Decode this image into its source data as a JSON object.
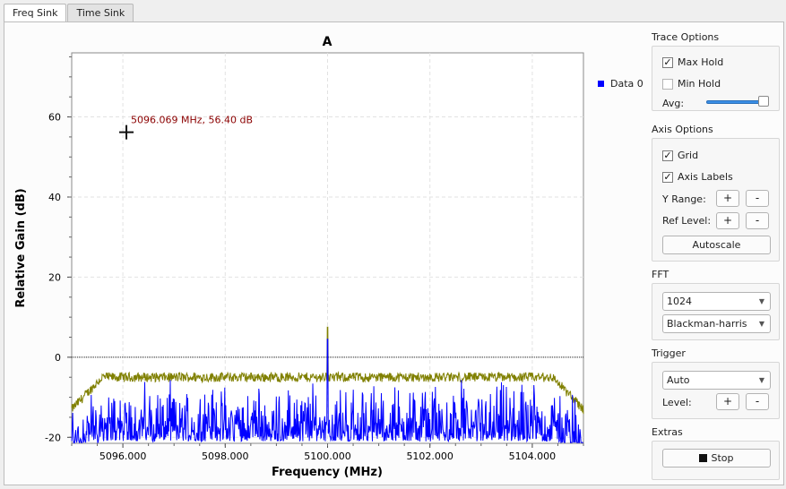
{
  "tabs": [
    {
      "label": "Freq Sink",
      "active": true
    },
    {
      "label": "Time Sink",
      "active": false
    }
  ],
  "plot": {
    "title": "A",
    "xlabel": "Frequency (MHz)",
    "ylabel": "Relative Gain (dB)",
    "legend": "Data 0",
    "legend_color": "#0000ff",
    "marker_readout": "5096.069 MHz, 56.40 dB"
  },
  "chart_data": {
    "type": "line",
    "title": "A",
    "xlabel": "Frequency (MHz)",
    "ylabel": "Relative Gain (dB)",
    "xlim": [
      5095.0,
      5105.0
    ],
    "ylim": [
      -21.5,
      76
    ],
    "x_ticks": [
      "5096.000",
      "5098.000",
      "5100.000",
      "5102.000",
      "5104.000"
    ],
    "x_tick_values": [
      5096,
      5098,
      5100,
      5102,
      5104
    ],
    "y_ticks": [
      "60",
      "40",
      "20",
      "0",
      "-20"
    ],
    "y_tick_values": [
      60,
      40,
      20,
      0,
      -20
    ],
    "grid": true,
    "series": [
      {
        "name": "Data 0",
        "color": "#0000ff",
        "description": "noise floor trace",
        "floor_db_range": [
          -21,
          -5
        ],
        "peak": {
          "x": 5100.0,
          "y": 4.5
        }
      },
      {
        "color": "#808000",
        "description": "max hold trace",
        "level_db": -5,
        "edge_db": -13,
        "peak": {
          "x": 5100.0,
          "y": 7.5
        }
      }
    ],
    "marker": {
      "x": 5096.069,
      "y": 56.4
    },
    "reference_line_db": 0
  },
  "trace_options": {
    "title": "Trace Options",
    "max_hold": {
      "label": "Max Hold",
      "checked": true
    },
    "min_hold": {
      "label": "Min Hold",
      "checked": false
    },
    "avg_label": "Avg:",
    "avg_value": 1.0
  },
  "axis_options": {
    "title": "Axis Options",
    "grid": {
      "label": "Grid",
      "checked": true
    },
    "axis_labels": {
      "label": "Axis Labels",
      "checked": true
    },
    "y_range_label": "Y Range:",
    "ref_level_label": "Ref Level:",
    "plus": "+",
    "minus": "-",
    "autoscale": "Autoscale"
  },
  "fft": {
    "title": "FFT",
    "size": "1024",
    "window": "Blackman-harris"
  },
  "trigger": {
    "title": "Trigger",
    "mode": "Auto",
    "level_label": "Level:"
  },
  "extras": {
    "title": "Extras",
    "stop_label": "Stop"
  }
}
